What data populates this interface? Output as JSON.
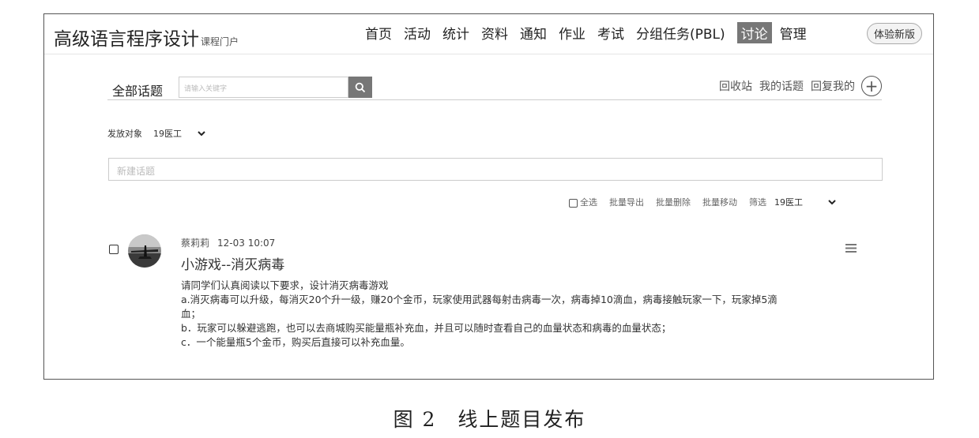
{
  "header": {
    "brand": "高级语言程序设计",
    "brand_sub": "课程门户",
    "nav": [
      "首页",
      "活动",
      "统计",
      "资料",
      "通知",
      "作业",
      "考试",
      "分组任务(PBL)",
      "讨论",
      "管理"
    ],
    "active_nav": "讨论",
    "new_version": "体验新版"
  },
  "discussion": {
    "all_topics": "全部话题",
    "search_placeholder": "请输入关键字",
    "links": [
      "回收站",
      "我的话题",
      "回复我的"
    ],
    "target_label": "发放对象",
    "target_value": "19医工",
    "new_topic_placeholder": "新建话题",
    "toolbar": {
      "select_all": "全选",
      "batch_export": "批量导出",
      "batch_delete": "批量删除",
      "batch_move": "批量移动",
      "filter_label": "筛选",
      "filter_value": "19医工"
    }
  },
  "post": {
    "author": "蔡莉莉",
    "time": "12-03 10:07",
    "title": "小游戏--消灭病毒",
    "lines": [
      "请同学们认真阅读以下要求，设计消灭病毒游戏",
      "a.消灭病毒可以升级，每消灭20个升一级，赚20个金币，玩家使用武器每射击病毒一次，病毒掉10滴血，病毒接触玩家一下，玩家掉5滴",
      "血；",
      "b．玩家可以躲避逃跑，也可以去商城购买能量瓶补充血，并且可以随时查看自己的血量状态和病毒的血量状态；",
      "c．一个能量瓶5个金币，购买后直接可以补充血量。"
    ]
  },
  "caption": "图 2　线上题目发布"
}
